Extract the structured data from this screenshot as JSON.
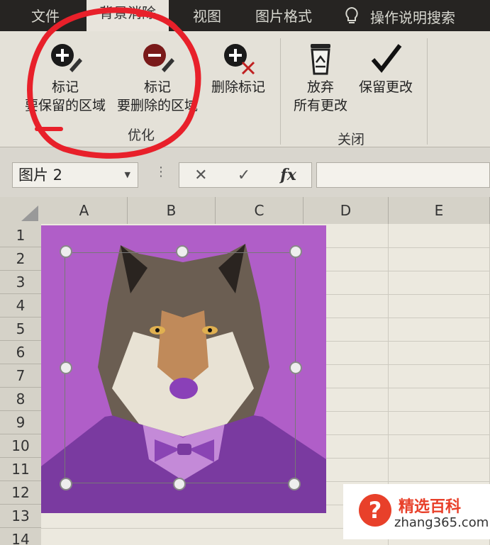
{
  "tabs": [
    {
      "label": "文件",
      "active": false
    },
    {
      "label": "背景消除",
      "active": true
    },
    {
      "label": "视图",
      "active": false
    },
    {
      "label": "图片格式",
      "active": false
    }
  ],
  "tell_me": "操作说明搜索",
  "ribbon": {
    "mark_keep": {
      "line1": "标记",
      "line2": "要保留的区域",
      "icon": "add-pencil-icon"
    },
    "mark_remove": {
      "line1": "标记",
      "line2": "要删除的区域",
      "icon": "minus-pencil-icon"
    },
    "delete_mark": {
      "label": "删除标记",
      "icon": "delete-mark-icon"
    },
    "discard": {
      "line1": "放弃",
      "line2": "所有更改",
      "icon": "recycle-bin-icon"
    },
    "keep": {
      "label": "保留更改",
      "icon": "checkmark-icon"
    },
    "group_optimize": "优化",
    "group_close": "关闭"
  },
  "formula_bar": {
    "name_box": "图片 2",
    "cancel": "✕",
    "enter": "✓",
    "fx": "fx"
  },
  "grid": {
    "columns": [
      "A",
      "B",
      "C",
      "D",
      "E"
    ],
    "rows": [
      "1",
      "2",
      "3",
      "4",
      "5",
      "6",
      "7",
      "8",
      "9",
      "10",
      "11",
      "12",
      "13",
      "14"
    ]
  },
  "watermark": {
    "icon": "?",
    "title": "精选百科",
    "url": "zhang365.com"
  },
  "colors": {
    "removal_overlay": "#b05ec8",
    "annotation": "#e8202a",
    "watermark_accent": "#e8402a"
  }
}
